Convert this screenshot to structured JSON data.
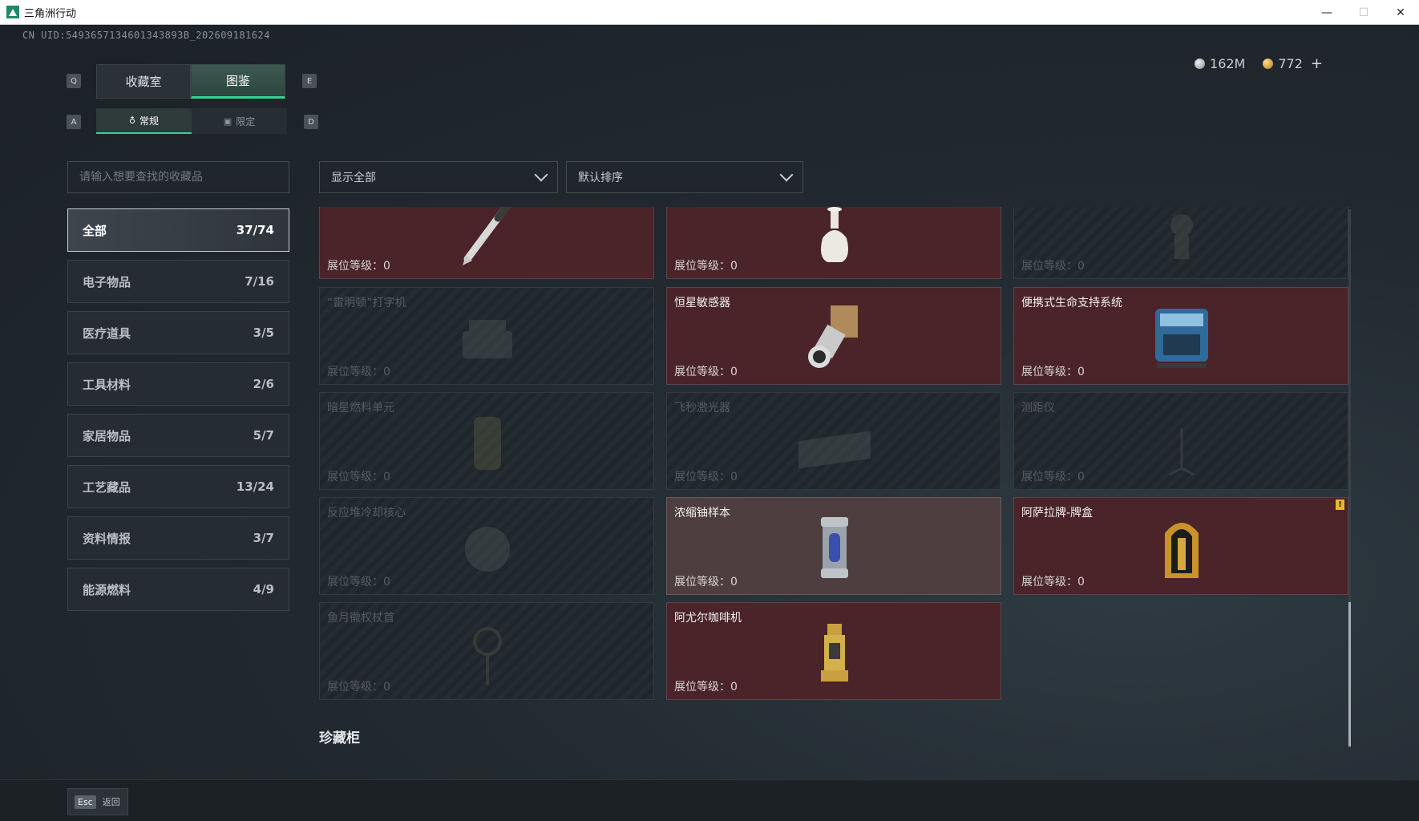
{
  "window": {
    "title": "三角洲行动",
    "minimize": "—",
    "maximize": "☐",
    "close": "✕"
  },
  "uid": "CN UID:5493657134601343893B_202609181624",
  "currency": {
    "silver": "162M",
    "gold": "772",
    "add": "+"
  },
  "keys": {
    "q": "Q",
    "e": "E",
    "a": "A",
    "d": "D"
  },
  "tabs": [
    {
      "label": "收藏室"
    },
    {
      "label": "图鉴",
      "active": true
    }
  ],
  "subtabs": [
    {
      "label": "常规",
      "icon": "♁",
      "active": true
    },
    {
      "label": "限定",
      "icon": "▣"
    }
  ],
  "search": {
    "placeholder": "请输入想要查找的收藏品"
  },
  "categories": [
    {
      "label": "全部",
      "count": "37/74",
      "active": true
    },
    {
      "label": "电子物品",
      "count": "7/16"
    },
    {
      "label": "医疗道具",
      "count": "3/5"
    },
    {
      "label": "工具材料",
      "count": "2/6"
    },
    {
      "label": "家居物品",
      "count": "5/7"
    },
    {
      "label": "工艺藏品",
      "count": "13/24"
    },
    {
      "label": "资料情报",
      "count": "3/7"
    },
    {
      "label": "能源燃料",
      "count": "4/9"
    }
  ],
  "filter": {
    "label": "显示全部"
  },
  "sort": {
    "label": "默认排序"
  },
  "cards": [
    {
      "name": "",
      "level": "展位等级：0",
      "state": "owned",
      "icon": "pen-icon"
    },
    {
      "name": "",
      "level": "展位等级：0",
      "state": "owned",
      "icon": "vase-icon"
    },
    {
      "name": "",
      "level": "展位等级：0",
      "state": "locked",
      "icon": "statue-icon"
    },
    {
      "name": "“雷明顿”打字机",
      "level": "展位等级：0",
      "state": "locked",
      "icon": "typewriter-icon"
    },
    {
      "name": "恒星敏感器",
      "level": "展位等级：0",
      "state": "owned",
      "icon": "sensor-icon"
    },
    {
      "name": "便携式生命支持系统",
      "level": "展位等级：0",
      "state": "owned",
      "icon": "life-support-icon"
    },
    {
      "name": "暗星燃料单元",
      "level": "展位等级：0",
      "state": "locked",
      "icon": "fuel-cell-icon"
    },
    {
      "name": "飞秒激光器",
      "level": "展位等级：0",
      "state": "locked",
      "icon": "laser-icon"
    },
    {
      "name": "测距仪",
      "level": "展位等级：0",
      "state": "locked",
      "icon": "rangefinder-icon"
    },
    {
      "name": "反应堆冷却核心",
      "level": "展位等级：0",
      "state": "locked",
      "icon": "reactor-core-icon"
    },
    {
      "name": "浓缩铀样本",
      "level": "展位等级：0",
      "state": "highlight",
      "icon": "uranium-sample-icon"
    },
    {
      "name": "阿萨拉牌-牌盒",
      "level": "展位等级：0",
      "state": "owned",
      "icon": "card-box-icon",
      "badge": "!"
    },
    {
      "name": "鱼月徽权杖首",
      "level": "展位等级：0",
      "state": "locked",
      "icon": "scepter-icon"
    },
    {
      "name": "阿尤尔咖啡机",
      "level": "展位等级：0",
      "state": "owned",
      "icon": "coffee-machine-icon"
    }
  ],
  "section_title": "珍藏柜",
  "esc": {
    "key": "Esc",
    "label": "返回"
  }
}
